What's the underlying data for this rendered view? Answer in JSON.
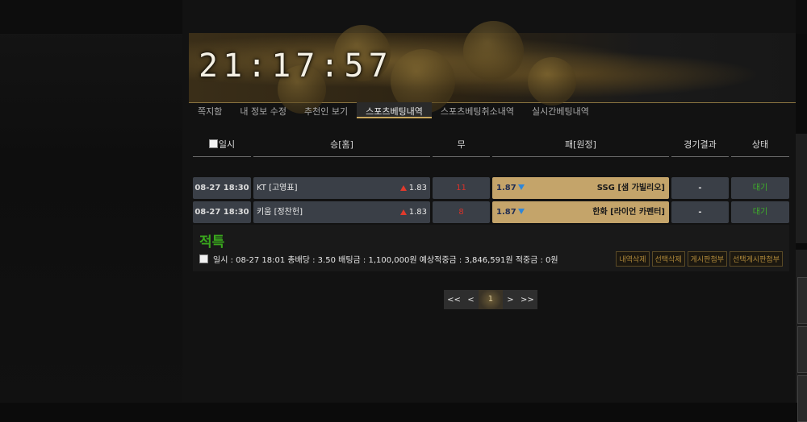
{
  "clock": "21:17:57",
  "nav": [
    "쪽지함",
    "내 정보 수정",
    "추천인 보기",
    "스포츠베팅내역",
    "스포츠베팅취소내역",
    "실시간베팅내역"
  ],
  "table_headers": {
    "date": "일시",
    "home": "승[홈]",
    "draw": "무",
    "away": "패[원정]",
    "result": "경기결과",
    "status": "상태"
  },
  "rows": [
    {
      "date": "08-27 18:30",
      "home_team": "KT [고영표]",
      "home_odd": "1.83",
      "draw": "11",
      "away_odd": "1.87",
      "away_team": "SSG [샘 가빌리오]",
      "result": "-",
      "status": "대기"
    },
    {
      "date": "08-27 18:30",
      "home_team": "키움 [정찬헌]",
      "home_odd": "1.83",
      "draw": "8",
      "away_odd": "1.87",
      "away_team": "한화 [라이언 카펜터]",
      "result": "-",
      "status": "대기"
    }
  ],
  "summary": {
    "title": "적특",
    "line": "일시 : 08-27 18:01  총배당 : 3.50  배팅금 : 1,100,000원  예상적중금 : 3,846,591원  적중금 : 0원",
    "buttons": [
      "내역삭제",
      "선택삭제",
      "게시판첨부",
      "선택게시판첨부"
    ]
  },
  "pager": {
    "first": "<<",
    "prev": "<",
    "current": "1",
    "next": ">",
    "last": ">>"
  },
  "colors": {
    "accent": "#c4a46a",
    "win": "#39a61d",
    "up": "#e03a2c",
    "down": "#2f86d8"
  }
}
